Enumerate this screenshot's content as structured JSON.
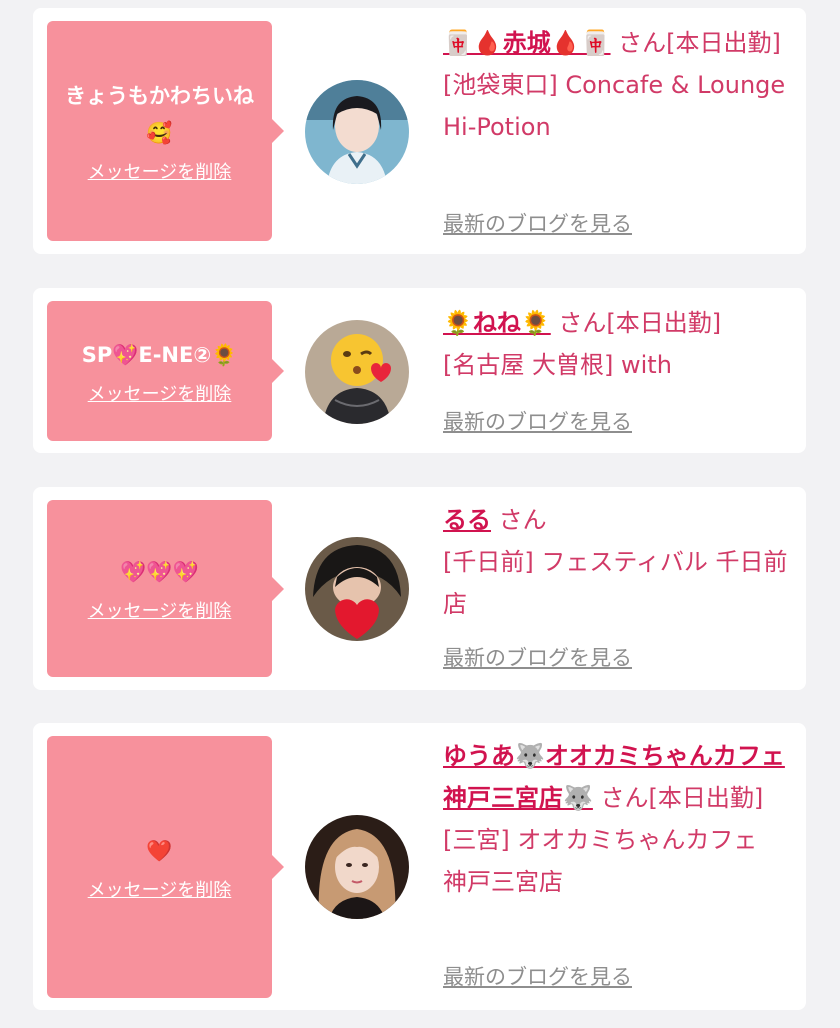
{
  "items": [
    {
      "message": "きょうもかわちいね🥰",
      "delete_label": "メッセージを削除",
      "name": "🀄🩸赤城🩸🀄",
      "san": "さん[本日出勤]",
      "shop": "[池袋東口] Concafe & Lounge Hi-Potion",
      "blog_label": "最新のブログを見る"
    },
    {
      "message": "SP💖E-NE②🌻",
      "delete_label": "メッセージを削除",
      "name": "🌻ねね🌻",
      "san": "さん[本日出勤]",
      "shop": "[名古屋 大曽根] with",
      "blog_label": "最新のブログを見る"
    },
    {
      "message": "💖💖💖",
      "delete_label": "メッセージを削除",
      "name": "るる",
      "san": "さん",
      "shop": "[千日前] フェスティバル 千日前店",
      "blog_label": "最新のブログを見る"
    },
    {
      "message": "❤️",
      "delete_label": "メッセージを削除",
      "name": "ゆうあ🐺オオカミちゃんカフェ神戸三宮店🐺",
      "san": "さん[本日出勤]",
      "shop": "[三宮] オオカミちゃんカフェ 神戸三宮店",
      "blog_label": "最新のブログを見る"
    }
  ],
  "colors": {
    "bubble": "#f7919c",
    "name": "#d1134f",
    "text": "#d13a67",
    "link_gray": "#8e8e8e",
    "background": "#f2f2f4"
  }
}
